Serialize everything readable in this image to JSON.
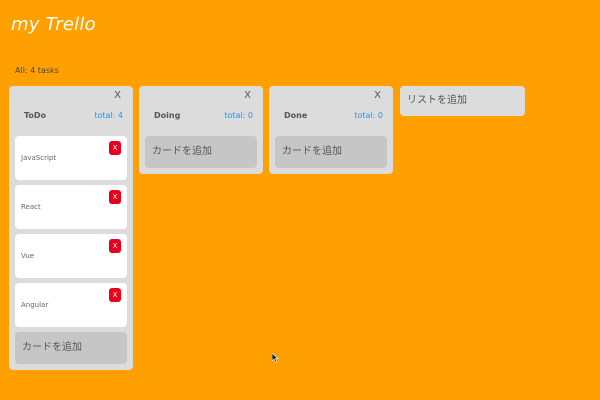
{
  "app": {
    "title": "my Trello"
  },
  "summary": {
    "text": "All: 4 tasks"
  },
  "lists": [
    {
      "title": "ToDo",
      "total": "total: 4",
      "close": "X",
      "cards": [
        {
          "text": "JavaScript",
          "delete": "X"
        },
        {
          "text": "React",
          "delete": "X"
        },
        {
          "text": "Vue",
          "delete": "X"
        },
        {
          "text": "Angular",
          "delete": "X"
        }
      ],
      "add_card": "カードを追加"
    },
    {
      "title": "Doing",
      "total": "total: 0",
      "close": "X",
      "cards": [],
      "add_card": "カードを追加"
    },
    {
      "title": "Done",
      "total": "total: 0",
      "close": "X",
      "cards": [],
      "add_card": "カードを追加"
    }
  ],
  "add_list": {
    "label": "リストを追加"
  },
  "colors": {
    "background": "#ffa000",
    "list_background": "#dcdcdc",
    "total_text": "#2196f3",
    "delete_button": "#e8001c"
  }
}
